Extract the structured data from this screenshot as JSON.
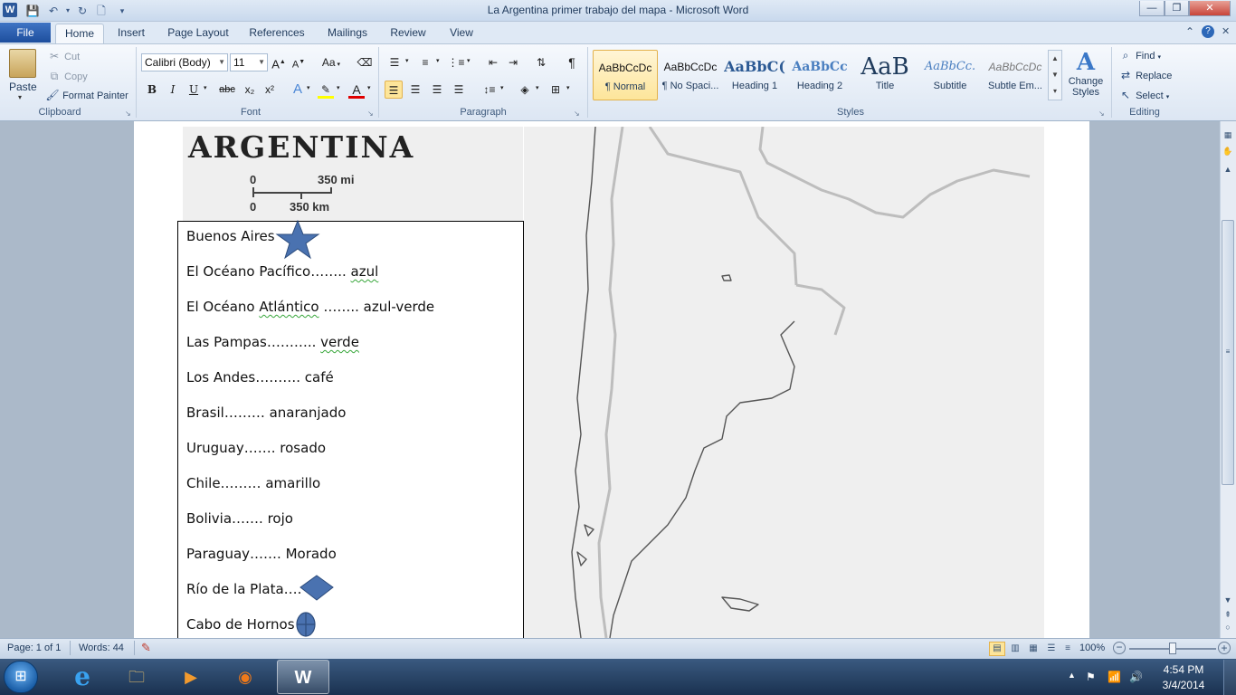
{
  "window": {
    "title": "La Argentina  primer trabajo del mapa  -  Microsoft Word",
    "app_icon": "W",
    "controls": {
      "minimize": "—",
      "restore": "❐",
      "close": "✕"
    }
  },
  "tabs": {
    "file": "File",
    "items": [
      "Home",
      "Insert",
      "Page Layout",
      "References",
      "Mailings",
      "Review",
      "View"
    ]
  },
  "clipboard": {
    "paste": "Paste",
    "cut": "Cut",
    "copy": "Copy",
    "format_painter": "Format Painter",
    "label": "Clipboard"
  },
  "font": {
    "family": "Calibri (Body)",
    "size": "11",
    "label": "Font",
    "grow": "A",
    "shrink": "A",
    "case": "Aa",
    "bold": "B",
    "italic": "I",
    "underline": "U",
    "strike": "abc",
    "subscript": "x₂",
    "superscript": "x²"
  },
  "paragraph": {
    "label": "Paragraph",
    "pilcrow": "¶"
  },
  "styles": {
    "label": "Styles",
    "items": [
      {
        "sample": "AaBbCcDc",
        "name": "¶ Normal"
      },
      {
        "sample": "AaBbCcDc",
        "name": "¶ No Spaci..."
      },
      {
        "sample": "AaBbC(",
        "name": "Heading 1"
      },
      {
        "sample": "AaBbCc",
        "name": "Heading 2"
      },
      {
        "sample": "AaB",
        "name": "Title"
      },
      {
        "sample": "AaBbCc.",
        "name": "Subtitle"
      },
      {
        "sample": "AaBbCcDc",
        "name": "Subtle Em..."
      }
    ],
    "change_styles": "Change Styles"
  },
  "editing": {
    "label": "Editing",
    "find": "Find",
    "replace": "Replace",
    "select": "Select"
  },
  "colors": {
    "highlight": "#ffff00",
    "font_color": "#e00000",
    "star_fill": "#4a72b0",
    "diamond_fill": "#4a72b0"
  },
  "document": {
    "map_title": "ARGENTINA",
    "scale": {
      "zero_top": "0",
      "mi": "350 mi",
      "zero_bottom": "0",
      "km": "350 km"
    },
    "legend": [
      {
        "place": "Buenos Aires",
        "dots": "",
        "color": "",
        "symbol": "star"
      },
      {
        "place": "El Océano Pacífico",
        "dots": "……..",
        "color": "azul",
        "symbol": ""
      },
      {
        "place": "El Océano Atlántico",
        "dots": " ……..",
        "color": "azul-verde",
        "symbol": ""
      },
      {
        "place": "Las Pampas",
        "dots": "………..",
        "color": "verde",
        "symbol": ""
      },
      {
        "place": "Los Andes",
        "dots": "……….",
        "color": "café",
        "symbol": ""
      },
      {
        "place": "Brasil",
        "dots": "……… ",
        "color": "anaranjado",
        "symbol": ""
      },
      {
        "place": "Uruguay",
        "dots": "……. ",
        "color": "rosado",
        "symbol": ""
      },
      {
        "place": "Chile",
        "dots": "……… ",
        "color": "amarillo",
        "symbol": ""
      },
      {
        "place": "Bolivia",
        "dots": "……. ",
        "color": "rojo",
        "symbol": ""
      },
      {
        "place": "Paraguay",
        "dots": "…….  ",
        "color": "Morado",
        "symbol": ""
      },
      {
        "place": "Río de la Plata",
        "dots": "….",
        "color": "",
        "symbol": "diamond"
      },
      {
        "place": "Cabo de Hornos",
        "dots": "",
        "color": "",
        "symbol": "circle-cross"
      }
    ]
  },
  "status": {
    "page": "Page: 1 of 1",
    "words": "Words: 44",
    "zoom": "100%"
  },
  "taskbar": {
    "time": "4:54 PM",
    "date": "3/4/2014"
  }
}
